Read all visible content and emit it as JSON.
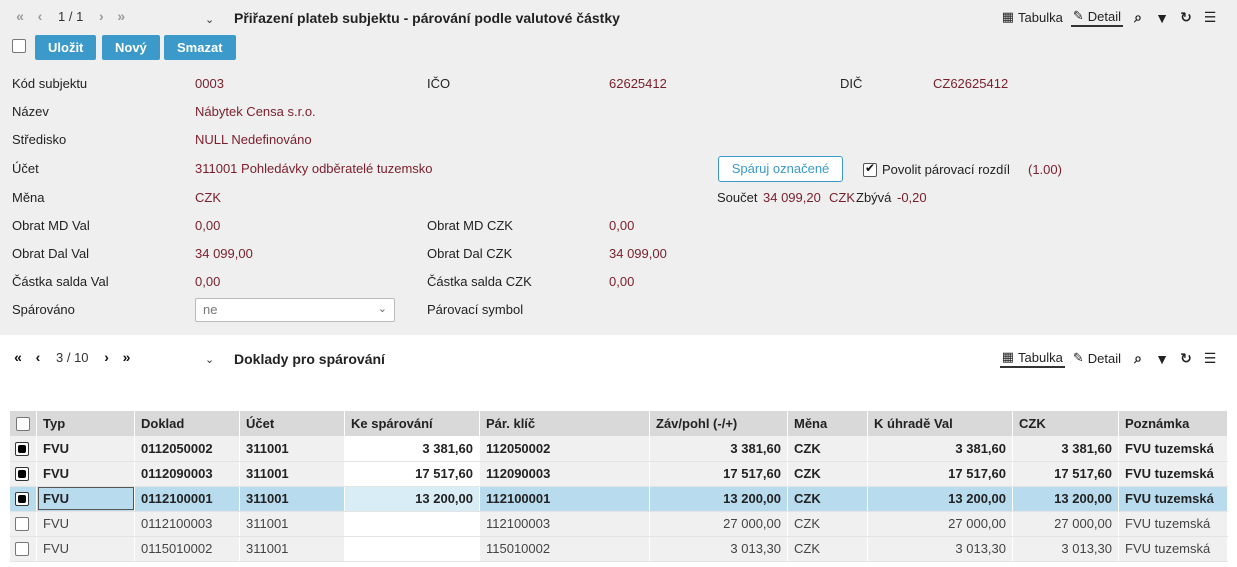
{
  "header": {
    "pager": "1 / 1",
    "title": "Přiřazení plateb subjektu - párování podle valutové částky",
    "view_table": "Tabulka",
    "view_detail": "Detail"
  },
  "actions": {
    "save": "Uložit",
    "new": "Nový",
    "delete": "Smazat"
  },
  "form": {
    "kod_label": "Kód subjektu",
    "kod_value": "0003",
    "ico_label": "IČO",
    "ico_value": "62625412",
    "dic_label": "DIČ",
    "dic_value": "CZ62625412",
    "nazev_label": "Název",
    "nazev_value": "Nábytek Censa s.r.o.",
    "stredisko_label": "Středisko",
    "stredisko_value": "NULL Nedefinováno",
    "ucet_label": "Účet",
    "ucet_value": "311001 Pohledávky odběratelé tuzemsko",
    "mena_label": "Měna",
    "mena_value": "CZK",
    "obrat_md_val_label": "Obrat MD Val",
    "obrat_md_val_value": "0,00",
    "obrat_md_czk_label": "Obrat MD CZK",
    "obrat_md_czk_value": "0,00",
    "obrat_dal_val_label": "Obrat Dal Val",
    "obrat_dal_val_value": "34 099,00",
    "obrat_dal_czk_label": "Obrat Dal CZK",
    "obrat_dal_czk_value": "34 099,00",
    "castka_val_label": "Částka salda Val",
    "castka_val_value": "0,00",
    "castka_czk_label": "Částka salda CZK",
    "castka_czk_value": "0,00",
    "sparovano_label": "Spárováno",
    "sparovano_value": "ne",
    "parovaci_symbol_label": "Párovací symbol"
  },
  "pairing": {
    "button": "Spáruj označené",
    "allow_label": "Povolit párovací rozdíl",
    "allow_value": "(1.00)",
    "soucet_label": "Součet",
    "soucet_value": "34 099,20",
    "currency": "CZK",
    "zbyva_label": "Zbývá",
    "zbyva_value": "-0,20"
  },
  "sub": {
    "pager": "3 / 10",
    "title": "Doklady pro spárování",
    "view_table": "Tabulka",
    "view_detail": "Detail"
  },
  "table": {
    "columns": [
      "Typ",
      "Doklad",
      "Účet",
      "Ke spárování",
      "Pár. klíč",
      "Záv/pohl (-/+)",
      "Měna",
      "K úhradě Val",
      "CZK",
      "Poznámka"
    ],
    "rows": [
      [
        "FVU",
        "0112050002",
        "311001",
        "3 381,60",
        "112050002",
        "3 381,60",
        "CZK",
        "3 381,60",
        "3 381,60",
        "FVU tuzemská"
      ],
      [
        "FVU",
        "0112090003",
        "311001",
        "17 517,60",
        "112090003",
        "17 517,60",
        "CZK",
        "17 517,60",
        "17 517,60",
        "FVU tuzemská"
      ],
      [
        "FVU",
        "0112100001",
        "311001",
        "13 200,00",
        "112100001",
        "13 200,00",
        "CZK",
        "13 200,00",
        "13 200,00",
        "FVU tuzemská"
      ],
      [
        "FVU",
        "0112100003",
        "311001",
        "",
        "112100003",
        "27 000,00",
        "CZK",
        "27 000,00",
        "27 000,00",
        "FVU tuzemská"
      ],
      [
        "FVU",
        "0115010002",
        "311001",
        "",
        "115010002",
        "3 013,30",
        "CZK",
        "3 013,30",
        "3 013,30",
        "FVU tuzemská"
      ]
    ]
  }
}
